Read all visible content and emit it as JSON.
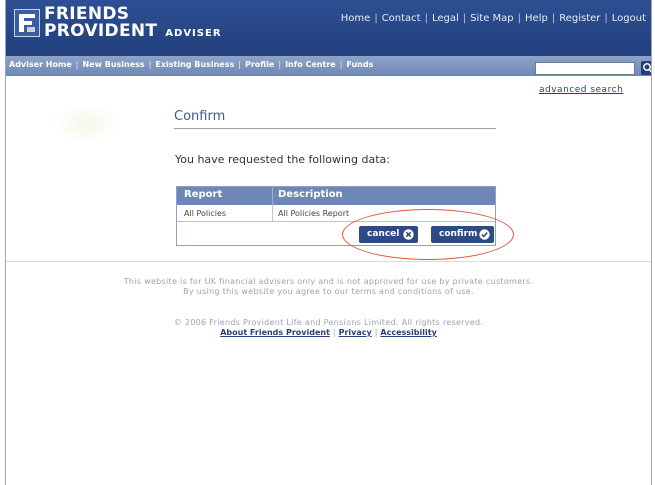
{
  "header": {
    "brand_line1": "FRIENDS",
    "brand_line2": "PROVIDENT",
    "brand_sub": "ADVISER",
    "top_nav": [
      "Home",
      "Contact",
      "Legal",
      "Site Map",
      "Help",
      "Register",
      "Logout"
    ]
  },
  "main_nav": [
    "Adviser Home",
    "New Business",
    "Existing Business",
    "Profile",
    "Info Centre",
    "Funds"
  ],
  "search": {
    "value": "",
    "advanced_label": "advanced search"
  },
  "page": {
    "title": "Confirm",
    "intro": "You have requested the following data:"
  },
  "table": {
    "headers": [
      "Report",
      "Description"
    ],
    "rows": [
      [
        "All Policies",
        "All Policies Report"
      ]
    ]
  },
  "buttons": {
    "cancel": "cancel",
    "confirm": "confirm"
  },
  "footer": {
    "line1": "This website is for UK financial advisers only and is not approved for use by private customers.",
    "line2": "By using this website you agree to our terms and conditions of use.",
    "copyright": "© 2006 Friends Provident Life and Pensions Limited. All rights reserved.",
    "links": [
      "About Friends Provident",
      "Privacy",
      "Accessibility"
    ]
  },
  "colors": {
    "header_blue": "#21407c",
    "nav_blue": "#6f87b5",
    "highlight": "#e0553a"
  }
}
